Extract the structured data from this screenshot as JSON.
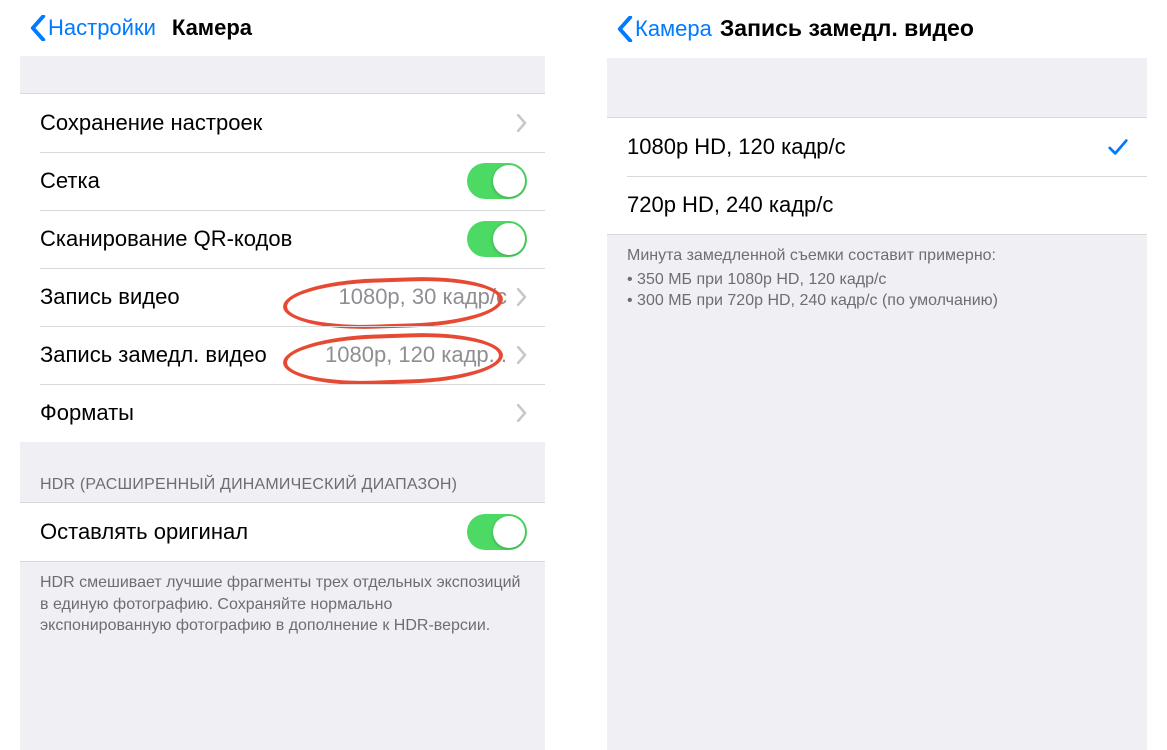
{
  "left": {
    "back": "Настройки",
    "title": "Камера",
    "rows": {
      "save_settings": "Сохранение настроек",
      "grid": "Сетка",
      "qr": "Сканирование QR-кодов",
      "video_record": {
        "label": "Запись видео",
        "value": "1080p, 30 кадр/с"
      },
      "slowmo": {
        "label": "Запись замедл. видео",
        "value": "1080p, 120 кадр..."
      },
      "formats": "Форматы"
    },
    "hdr_header": "HDR (РАСШИРЕННЫЙ ДИНАМИЧЕСКИЙ ДИАПАЗОН)",
    "keep_original": "Оставлять оригинал",
    "hdr_footer": "HDR смешивает лучшие фрагменты трех отдельных экспозиций в единую фотографию. Сохраняйте нормально экспонированную фотографию в дополнение к HDR-версии."
  },
  "right": {
    "back": "Камера",
    "title": "Запись замедл. видео",
    "options": {
      "o1": "1080p HD, 120 кадр/с",
      "o2": "720p HD, 240 кадр/с"
    },
    "footer_lead": "Минута замедленной съемки составит примерно:",
    "footer_items": {
      "i1": "350 МБ при 1080p HD, 120 кадр/с",
      "i2": "300 МБ при 720p HD, 240 кадр/с (по умолчанию)"
    }
  }
}
